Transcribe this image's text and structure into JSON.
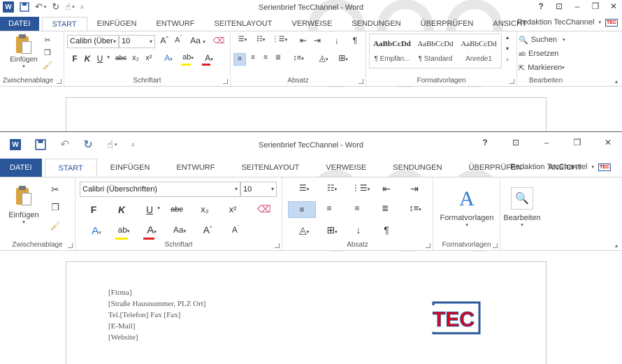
{
  "app": {
    "window_title": "Serienbrief TecChannel - Word",
    "account_name": "Redaktion TecChannel",
    "account_badge": "TEC"
  },
  "tabs": [
    "DATEI",
    "START",
    "EINFÜGEN",
    "ENTWURF",
    "SEITENLAYOUT",
    "VERWEISE",
    "SENDUNGEN",
    "ÜBERPRÜFEN",
    "ANSICHT"
  ],
  "active_tab": "START",
  "top_ribbon": {
    "clipboard": {
      "paste": "Einfügen",
      "label": "Zwischenablage"
    },
    "font": {
      "name": "Calibri (Über",
      "size": "10",
      "case_label": "Aa",
      "label": "Schriftart"
    },
    "paragraph": {
      "label": "Absatz"
    },
    "styles": {
      "label": "Formatvorlagen",
      "items": [
        {
          "sample": "AaBbCcDd",
          "name": "¶ Empfän..."
        },
        {
          "sample": "AaBbCcDd",
          "name": "¶ Standard"
        },
        {
          "sample": "AaBbCcDd",
          "name": "Anrede1"
        }
      ]
    },
    "editing": {
      "find": "Suchen",
      "replace": "Ersetzen",
      "select": "Markieren",
      "label": "Bearbeiten"
    }
  },
  "bottom_ribbon": {
    "clipboard": {
      "paste": "Einfügen",
      "label": "Zwischenablage"
    },
    "font": {
      "name": "Calibri (Überschriften)",
      "size": "10",
      "case_label": "Aa",
      "label": "Schriftart"
    },
    "paragraph": {
      "label": "Absatz"
    },
    "styles": {
      "button": "Formatvorlagen",
      "label": "Formatvorlagen"
    },
    "editing": {
      "button": "Bearbeiten"
    }
  },
  "font_buttons": {
    "bold": "F",
    "italic": "K",
    "underline": "U",
    "strike": "abc",
    "sub": "x₂",
    "sup": "x²"
  },
  "document": {
    "lines": [
      "[Firma]",
      "[Straße Hausnummer, PLZ Ort]",
      "Tel.[Telefon] Fax [Fax]",
      "[E-Mail]",
      "[Website]"
    ],
    "logo_text": "TEC"
  },
  "colors": {
    "accent": "#2b579a",
    "highlight": "#ffeb00",
    "font_color": "#e02020",
    "logo_red": "#e2001a"
  }
}
